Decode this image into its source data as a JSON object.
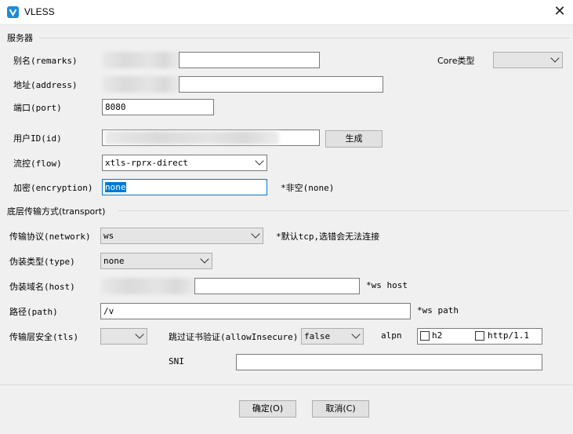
{
  "window": {
    "title": "VLESS",
    "close_glyph": "✕"
  },
  "server_section": {
    "title": "服务器",
    "remarks_label": "别名(remarks)",
    "remarks_value": "",
    "core_type_label": "Core类型",
    "core_type_value": "",
    "address_label": "地址(address)",
    "address_value": "",
    "port_label": "端口(port)",
    "port_value": "8080",
    "id_label": "用户ID(id)",
    "id_value": "",
    "generate_button": "生成",
    "flow_label": "流控(flow)",
    "flow_value": "xtls-rprx-direct",
    "encryption_label": "加密(encryption)",
    "encryption_value": "none",
    "encryption_hint": "*非空(none)"
  },
  "transport_section": {
    "title": "底层传输方式(transport)",
    "network_label": "传输协议(network)",
    "network_value": "ws",
    "network_hint": "*默认tcp,选错会无法连接",
    "type_label": "伪装类型(type)",
    "type_value": "none",
    "host_label": "伪装域名(host)",
    "host_value": "",
    "host_hint": "*ws host",
    "path_label": "路径(path)",
    "path_value": "/v",
    "path_hint": "*ws path",
    "tls_label": "传输层安全(tls)",
    "tls_value": "",
    "allow_insecure_label": "跳过证书验证(allowInsecure)",
    "allow_insecure_value": "false",
    "alpn_label": "alpn",
    "alpn_options": [
      {
        "label": "h2",
        "checked": false
      },
      {
        "label": "http/1.1",
        "checked": false
      }
    ],
    "sni_label": "SNI",
    "sni_value": ""
  },
  "footer": {
    "ok_button": "确定(O)",
    "cancel_button": "取消(C)"
  },
  "colors": {
    "accent": "#0078d7",
    "app_icon": "#1e8ad6"
  }
}
